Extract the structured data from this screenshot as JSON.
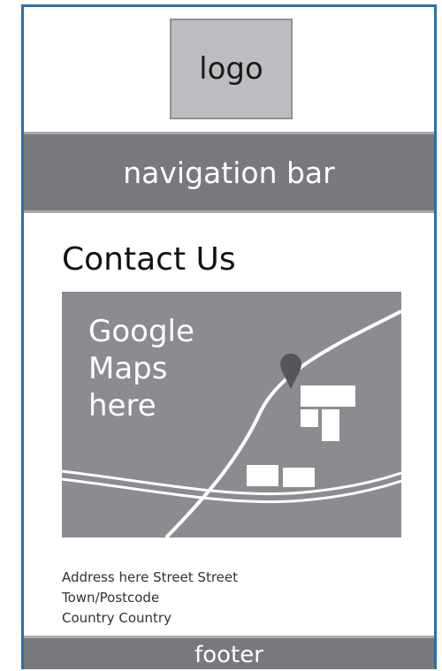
{
  "header": {
    "logo_label": "logo"
  },
  "nav": {
    "label": "navigation bar"
  },
  "main": {
    "title": "Contact Us",
    "map": {
      "label": "Google\nMaps\nhere"
    },
    "address": {
      "lines": [
        "Address here Street Street",
        "Town/Postcode",
        "Country Country"
      ]
    }
  },
  "footer": {
    "label": "footer"
  }
}
